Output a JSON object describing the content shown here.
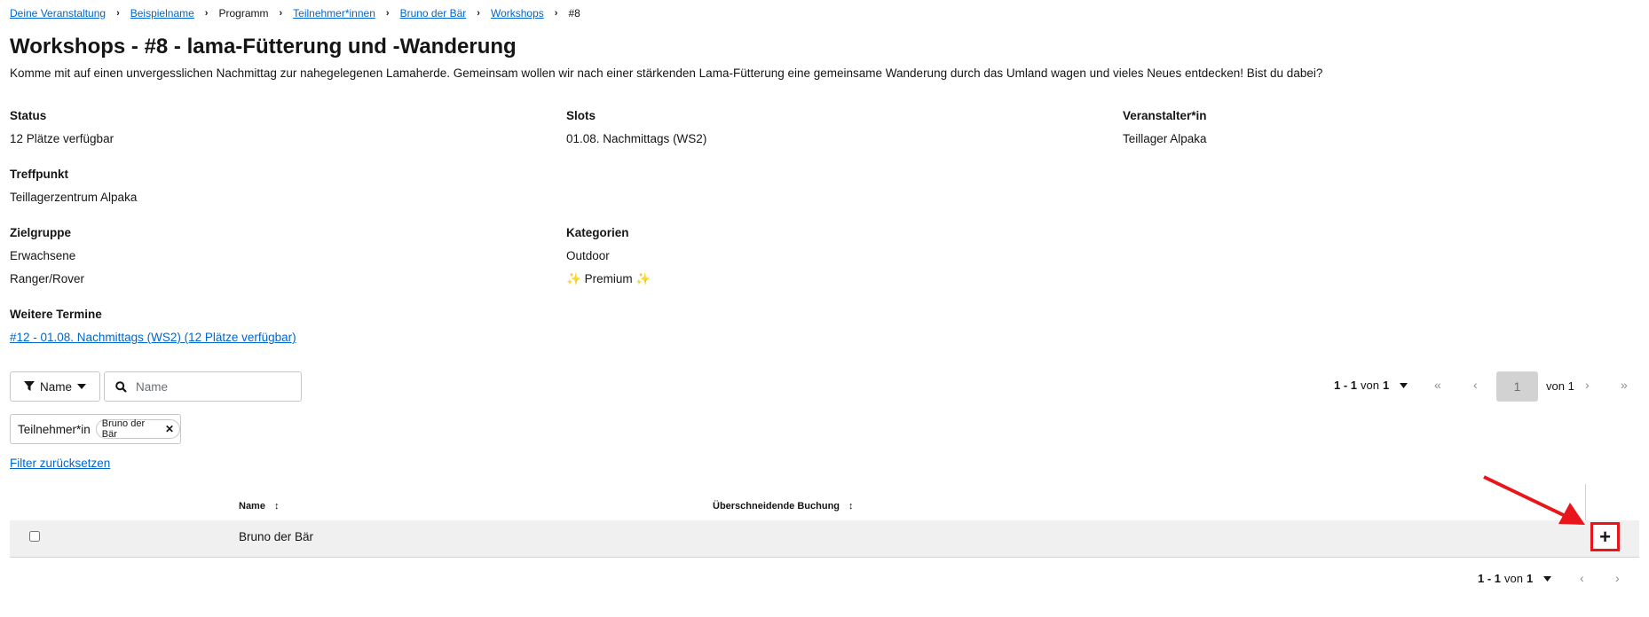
{
  "breadcrumb": {
    "items": [
      "Deine Veranstaltung",
      "Beispielname",
      "Programm",
      "Teilnehmer*innen",
      "Bruno der Bär",
      "Workshops",
      "#8"
    ]
  },
  "page": {
    "title": "Workshops - #8 - lama-Fütterung und -Wanderung",
    "description": "Komme mit auf einen unvergesslichen Nachmittag zur nahegelegenen Lamaherde. Gemeinsam wollen wir nach einer stärkenden Lama-Fütterung eine gemeinsame Wanderung durch das Umland wagen und vieles Neues entdecken! Bist du dabei?"
  },
  "details": {
    "status_label": "Status",
    "status_value": "12 Plätze verfügbar",
    "slots_label": "Slots",
    "slots_value": "01.08. Nachmittags (WS2)",
    "organizer_label": "Veranstalter*in",
    "organizer_value": "Teillager Alpaka",
    "meeting_label": "Treffpunkt",
    "meeting_value": "Teillagerzentrum Alpaka",
    "audience_label": "Zielgruppe",
    "audience_values": [
      "Erwachsene",
      "Ranger/Rover"
    ],
    "categories_label": "Kategorien",
    "categories_values": [
      "Outdoor",
      "Premium"
    ],
    "premium_sparkle": "✨",
    "more_dates_label": "Weitere Termine",
    "more_dates_link": "#12 - 01.08. Nachmittags (WS2) (12 Plätze verfügbar)"
  },
  "toolbar": {
    "filter_attribute": "Name",
    "search_placeholder": "Name",
    "chip_group_label": "Teilnehmer*in",
    "chip_label": "Bruno der Bär",
    "reset_label": "Filter zurücksetzen"
  },
  "pagination": {
    "range": "1 - 1",
    "of_label": "von",
    "total": "1",
    "current_page": "1",
    "page_of": "von 1"
  },
  "table": {
    "columns": [
      "Name",
      "Überschneidende Buchung"
    ],
    "rows": [
      {
        "name": "Bruno der Bär",
        "overlap": ""
      }
    ],
    "add_label": "+"
  },
  "colors": {
    "link": "#0066cc",
    "highlight": "#e8161a",
    "row_bg": "#f0f0f0"
  }
}
